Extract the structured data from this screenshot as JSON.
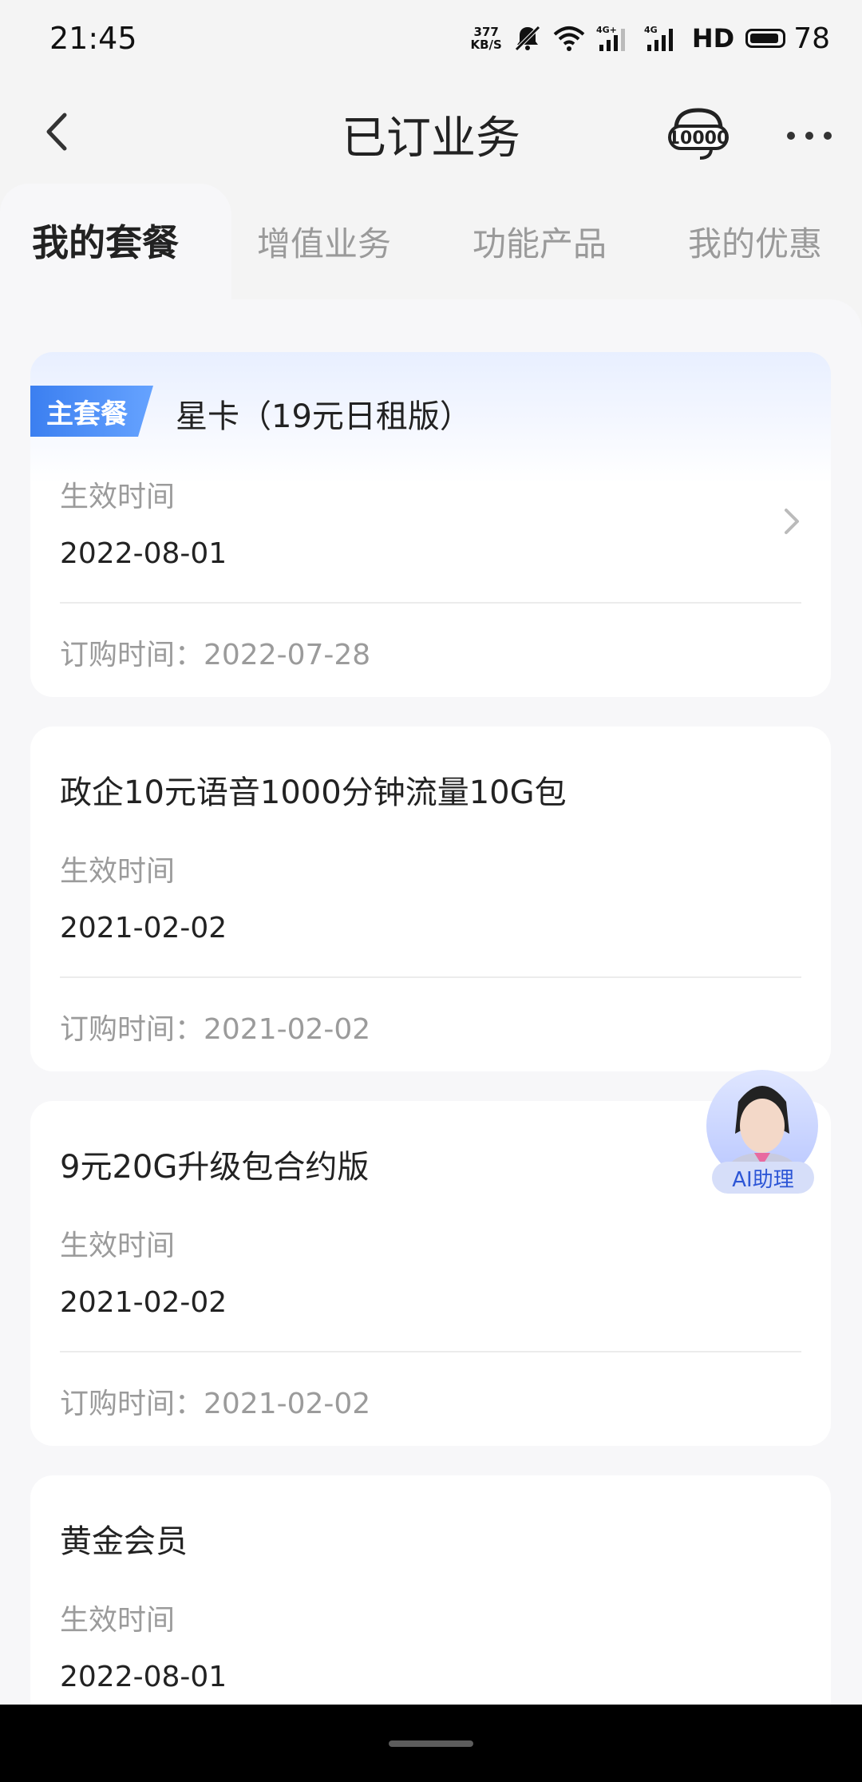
{
  "status_bar": {
    "time": "21:45",
    "net_speed_value": "377",
    "net_speed_unit": "KB/S",
    "signal1_tech": "4G+",
    "signal2_tech": "4G",
    "hd_label": "HD",
    "battery": "78"
  },
  "header": {
    "title": "已订业务",
    "service_icon_text": "10000"
  },
  "tabs": [
    {
      "label": "我的套餐",
      "active": true
    },
    {
      "label": "增值业务",
      "active": false
    },
    {
      "label": "功能产品",
      "active": false
    },
    {
      "label": "我的优惠",
      "active": false
    }
  ],
  "cards": [
    {
      "badge": "主套餐",
      "title": "星卡（19元日租版）",
      "effective_label": "生效时间",
      "effective_date": "2022-08-01",
      "order_text": "订购时间：2022-07-28"
    },
    {
      "title": "政企10元语音1000分钟流量10G包",
      "effective_label": "生效时间",
      "effective_date": "2021-02-02",
      "order_text": "订购时间：2021-02-02"
    },
    {
      "title": "9元20G升级包合约版",
      "effective_label": "生效时间",
      "effective_date": "2021-02-02",
      "order_text": "订购时间：2021-02-02"
    },
    {
      "title": "黄金会员",
      "effective_label": "生效时间",
      "effective_date": "2022-08-01"
    }
  ],
  "ai_assistant": {
    "label": "AI助理"
  },
  "colors": {
    "accent": "#3a7ef0",
    "page_bg": "#f4f4f4",
    "muted_text": "#9b9b9b"
  }
}
